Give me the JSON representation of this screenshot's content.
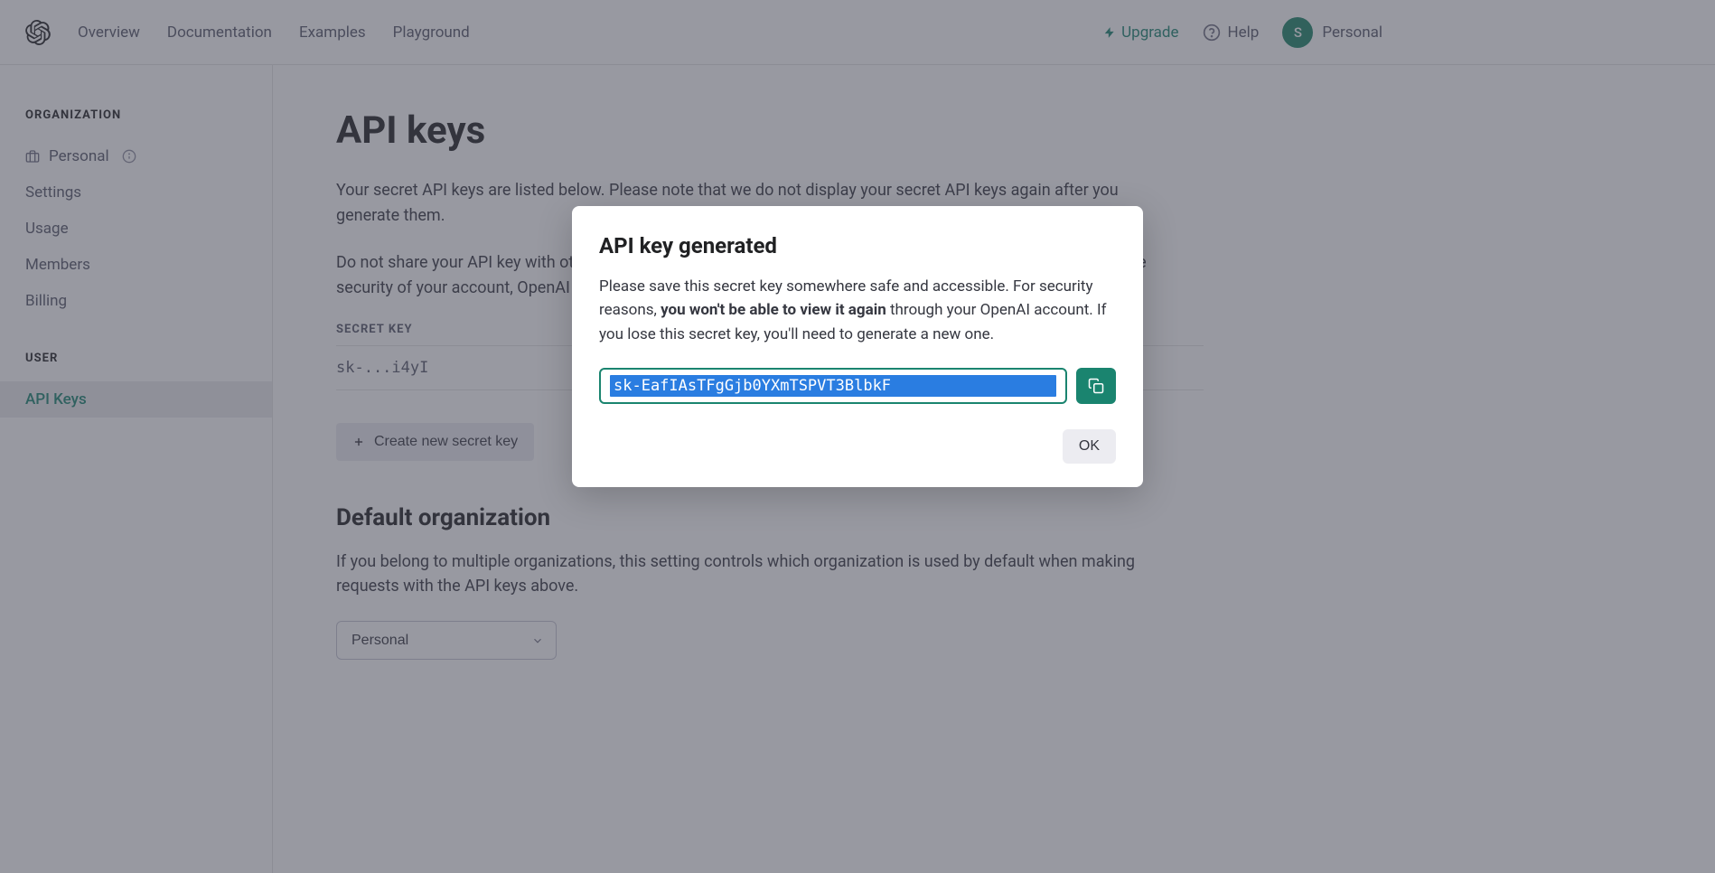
{
  "header": {
    "nav": [
      "Overview",
      "Documentation",
      "Examples",
      "Playground"
    ],
    "upgrade": "Upgrade",
    "help": "Help",
    "user_label": "Personal",
    "avatar_initial": "S"
  },
  "sidebar": {
    "org_heading": "ORGANIZATION",
    "org_name": "Personal",
    "org_items": [
      "Settings",
      "Usage",
      "Members",
      "Billing"
    ],
    "user_heading": "USER",
    "user_items": [
      "API Keys"
    ]
  },
  "main": {
    "title": "API keys",
    "para1": "Your secret API keys are listed below. Please note that we do not display your secret API keys again after you generate them.",
    "para2": "Do not share your API key with others, or expose it in the browser or other client-side code. In order to protect the security of your account, OpenAI may also automatically rotate any API key that we've found has leaked publicly.",
    "table_heading": "SECRET KEY",
    "table_row": "sk-...i4yI",
    "create_btn": "Create new secret key",
    "default_org_title": "Default organization",
    "default_org_para": "If you belong to multiple organizations, this setting controls which organization is used by default when making requests with the API keys above.",
    "select_value": "Personal"
  },
  "modal": {
    "title": "API key generated",
    "text_pre": "Please save this secret key somewhere safe and accessible. For security reasons, ",
    "text_bold": "you won't be able to view it again",
    "text_post": " through your OpenAI account. If you lose this secret key, you'll need to generate a new one.",
    "key_visible": "sk-EafIAsTFgGjb0YXmTSPVT3BlbkF",
    "ok": "OK"
  }
}
